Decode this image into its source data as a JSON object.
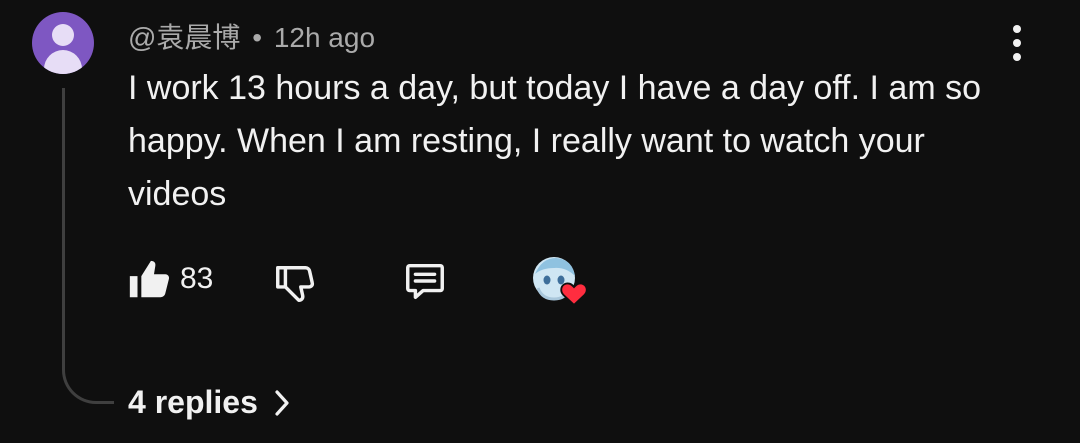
{
  "comment": {
    "author": "@袁晨博",
    "time": "12h ago",
    "separator": "•",
    "text": "I work 13 hours a day, but today I have a day off. I am so happy. When I am resting, I really want to watch your videos",
    "likes": "83",
    "replies_label": "4 replies"
  },
  "colors": {
    "background": "#0f0f0f",
    "avatar": "#7e57c2",
    "heart": "#ff2d3f",
    "secondary_text": "#aaaaaa"
  },
  "icons": {
    "like": "thumbs-up-icon",
    "dislike": "thumbs-down-icon",
    "reply": "comment-icon",
    "creator_heart": "heart-icon",
    "more": "more-vert-icon",
    "replies": "chevron-right-icon"
  }
}
